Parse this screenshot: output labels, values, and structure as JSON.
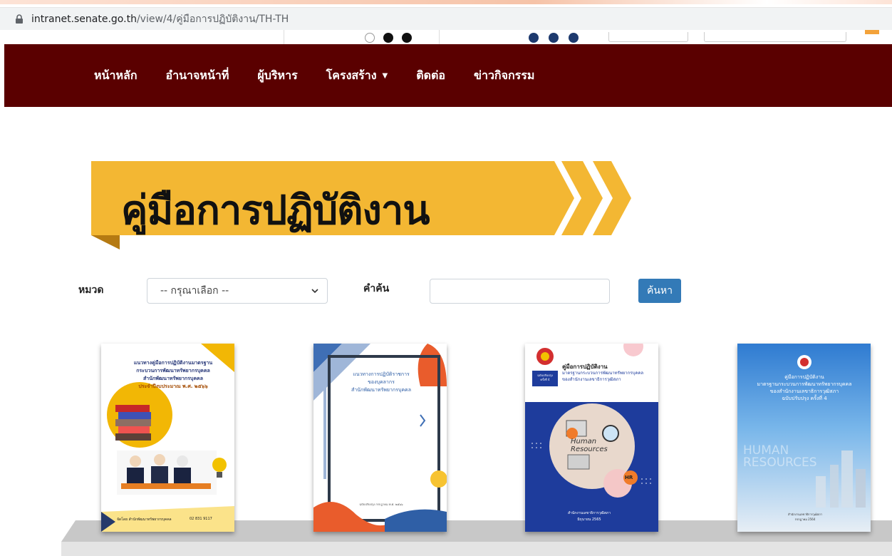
{
  "browser": {
    "url_host": "intranet.senate.go.th",
    "url_path": "/view/4/คู่มือการปฏิบัติงาน/TH-TH"
  },
  "nav": {
    "items": [
      {
        "label": "หน้าหลัก"
      },
      {
        "label": "อำนาจหน้าที่"
      },
      {
        "label": "ผู้บริหาร"
      },
      {
        "label": "โครงสร้าง",
        "dropdown": true
      },
      {
        "label": "ติดต่อ"
      },
      {
        "label": "ข่าวกิจกรรม"
      }
    ]
  },
  "banner": {
    "title": "คู่มือการปฏิบัติงาน"
  },
  "filter": {
    "category_label": "หมวด",
    "category_selected": "-- กรุณาเลือก --",
    "keyword_label": "คำค้น",
    "keyword_value": "",
    "search_button": "ค้นหา"
  },
  "books": [
    {
      "title_lines": [
        "แนวทางคู่มือการปฏิบัติงานมาตรฐาน",
        "กระบวนการพัฒนาทรัพยากรบุคคล",
        "สำนักพัฒนาทรัพยากรบุคคล",
        "ประจำปีงบประมาณ พ.ศ. ๒๕๖๖"
      ],
      "footer": "จัดโดย สำนักพัฒนาทรัพยากรบุคคล",
      "phone": "02 831 9117"
    },
    {
      "title_lines": [
        "แนวทางการปฏิบัติราชการ",
        "ของบุคลากร",
        "สำนักพัฒนาทรัพยากรบุคคล"
      ],
      "footer": "ฉบับปรับปรุง กรกฎาคม พ.ศ. ๒๕๖๖"
    },
    {
      "badge_lines": [
        "ฉบับปรับปรุง",
        "ครั้งที่ 4"
      ],
      "title_lines": [
        "คู่มือการปฏิบัติงาน",
        "มาตรฐานกระบวนการพัฒนาทรัพยากรบุคคล",
        "ของสำนักงานเลขาธิการวุฒิสภา"
      ],
      "art_lines": [
        "Human",
        "Resources"
      ],
      "hr": "HR",
      "footer_lines": [
        "สำนักงานเลขาธิการวุฒิสภา",
        "มิถุนายน 2565"
      ]
    },
    {
      "title_lines": [
        "คู่มือการปฏิบัติงาน",
        "มาตรฐานกระบวนการพัฒนาทรัพยากรบุคคล",
        "ของสำนักงานเลขาธิการวุฒิสภา",
        "ฉบับปรับปรุง ครั้งที่ 4"
      ],
      "art_lines": [
        "HUMAN",
        "RESOURCES"
      ],
      "footer_lines": [
        "สำนักงานเลขาธิการวุฒิสภา",
        "กรกฎาคม 2564"
      ]
    }
  ],
  "colors": {
    "navbar": "#5a0000",
    "banner_yellow": "#f3b733",
    "banner_shadow": "#b57a12",
    "button": "#337ab7"
  }
}
